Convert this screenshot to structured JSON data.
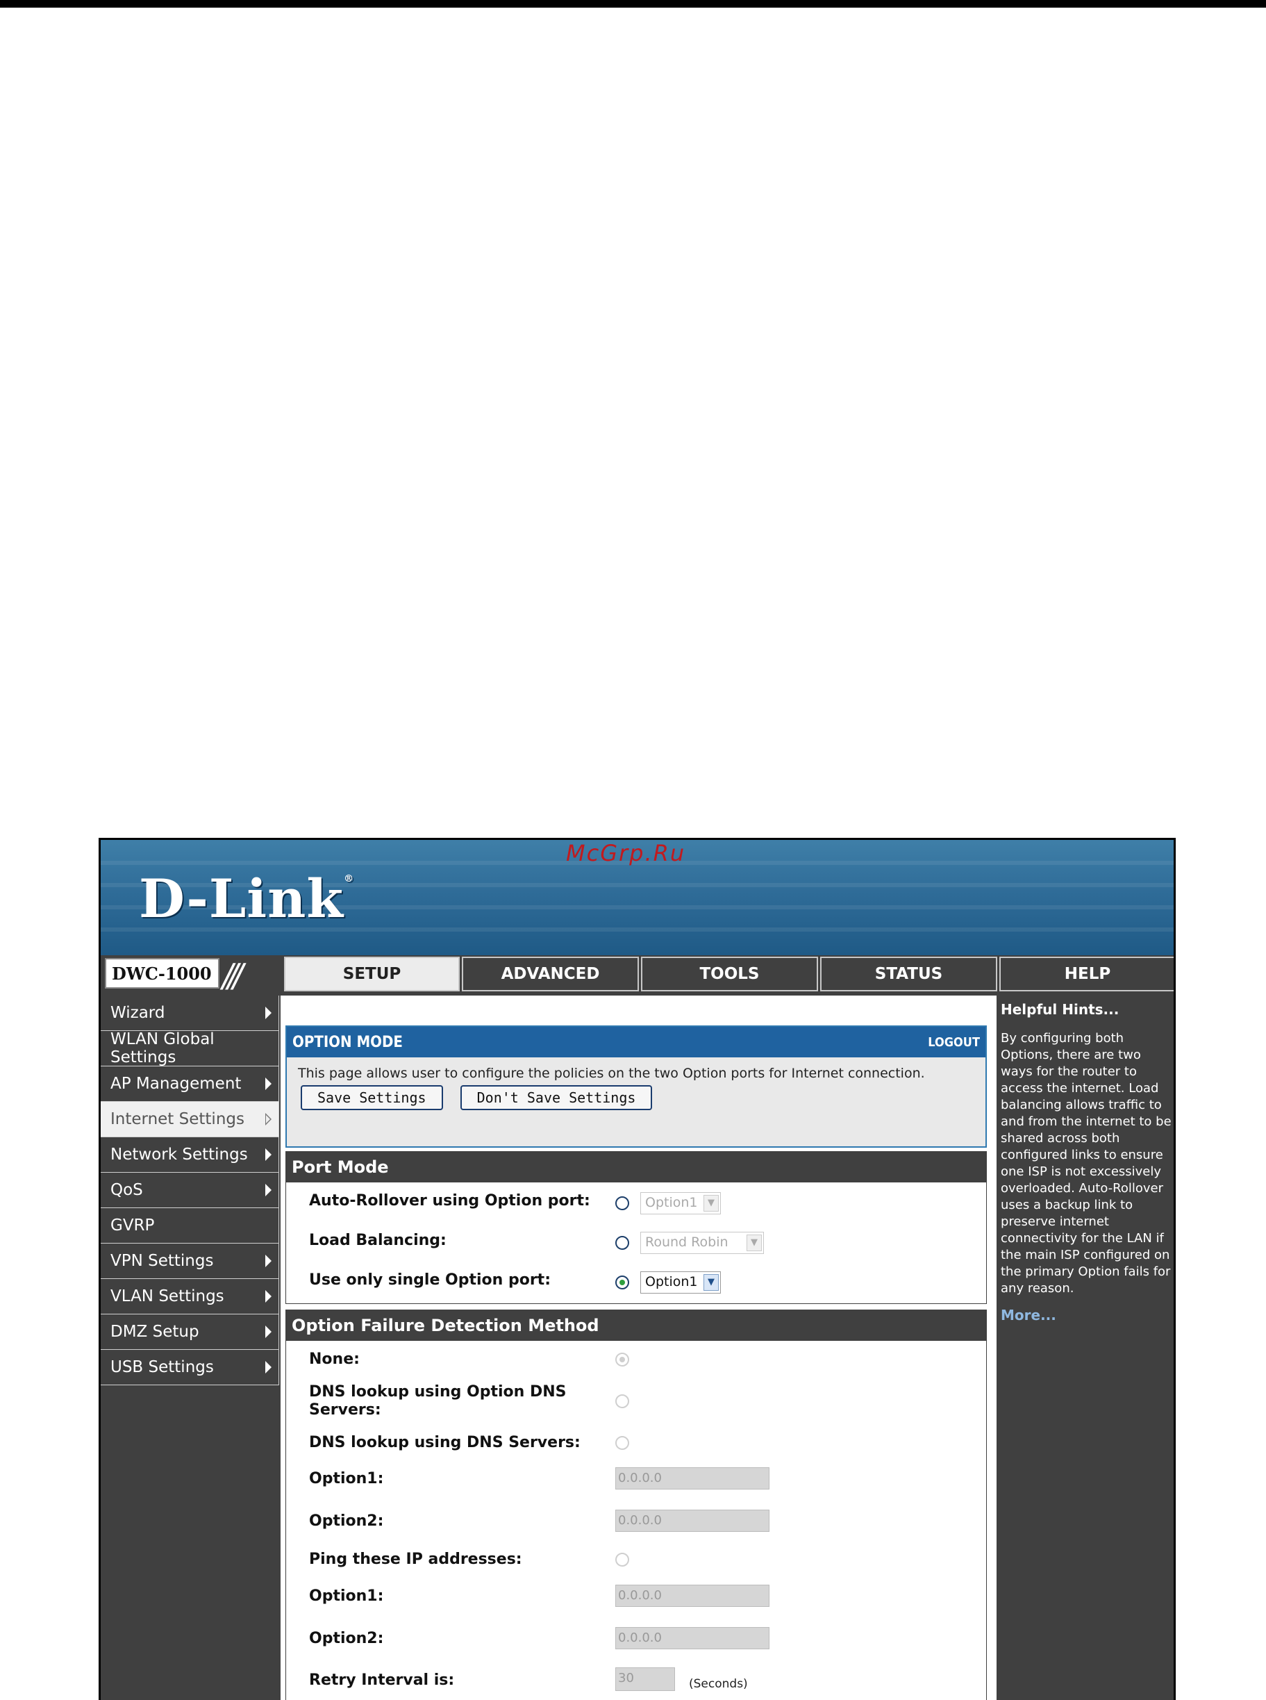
{
  "watermark": "McGrp.Ru",
  "brand": {
    "logo": "D-Link",
    "reg": "®",
    "model": "DWC-1000"
  },
  "tabs": [
    {
      "label": "SETUP",
      "active": true
    },
    {
      "label": "ADVANCED"
    },
    {
      "label": "TOOLS"
    },
    {
      "label": "STATUS"
    },
    {
      "label": "HELP"
    }
  ],
  "sidebar": {
    "items": [
      {
        "label": "Wizard"
      },
      {
        "label": "WLAN Global Settings"
      },
      {
        "label": "AP Management"
      },
      {
        "label": "Internet Settings",
        "active": true
      },
      {
        "label": "Network Settings"
      },
      {
        "label": "QoS"
      },
      {
        "label": "GVRP"
      },
      {
        "label": "VPN Settings"
      },
      {
        "label": "VLAN Settings"
      },
      {
        "label": "DMZ Setup"
      },
      {
        "label": "USB Settings"
      }
    ]
  },
  "option_mode": {
    "title": "OPTION MODE",
    "logout": "LOGOUT",
    "description": "This page allows user to configure the policies on the two Option ports for Internet connection.",
    "save_label": "Save Settings",
    "dont_save_label": "Don't Save Settings"
  },
  "port_mode": {
    "title": "Port Mode",
    "auto_rollover": {
      "label": "Auto-Rollover using Option port:",
      "select": "Option1"
    },
    "load_balancing": {
      "label": "Load Balancing:",
      "select": "Round Robin"
    },
    "single_port": {
      "label": "Use only single Option port:",
      "select": "Option1"
    }
  },
  "failure": {
    "title": "Option Failure Detection Method",
    "none_label": "None:",
    "dns_option_label": "DNS lookup using Option DNS Servers:",
    "dns_servers_label": "DNS lookup using DNS Servers:",
    "dns_option1_label": "Option1:",
    "dns_option1_value": "0.0.0.0",
    "dns_option2_label": "Option2:",
    "dns_option2_value": "0.0.0.0",
    "ping_label": "Ping these IP addresses:",
    "ping_option1_label": "Option1:",
    "ping_option1_value": "0.0.0.0",
    "ping_option2_label": "Option2:",
    "ping_option2_value": "0.0.0.0",
    "retry_label": "Retry Interval is:",
    "retry_value": "30",
    "retry_unit": "(Seconds)"
  },
  "help": {
    "title": "Helpful Hints...",
    "body": "By configuring both Options, there are two ways for the router to access the internet. Load balancing allows traffic to and from the internet to be shared across both configured links to ensure one ISP is not excessively overloaded. Auto-Rollover uses a backup link to preserve internet connectivity for the LAN if the main ISP configured on the primary Option fails for any reason.",
    "more": "More..."
  }
}
